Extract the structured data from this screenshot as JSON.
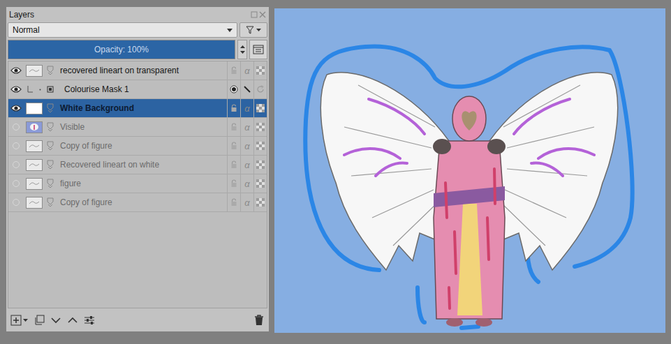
{
  "docker": {
    "title": "Layers",
    "blend_mode": "Normal",
    "opacity": {
      "label": "Opacity:  100%",
      "level": 1.0
    }
  },
  "alpha_glyph": "α",
  "layers": [
    {
      "name": "recovered lineart on transparent",
      "visible": true,
      "selected": false,
      "kind": "paint",
      "thumb": "sketch"
    },
    {
      "name": "Colourise Mask 1",
      "visible": true,
      "selected": false,
      "kind": "mask",
      "thumb": "none"
    },
    {
      "name": "White Background",
      "visible": true,
      "selected": true,
      "kind": "paint",
      "thumb": "white"
    },
    {
      "name": "Visible",
      "visible": false,
      "selected": false,
      "kind": "paint",
      "thumb": "color"
    },
    {
      "name": "Copy of figure",
      "visible": false,
      "selected": false,
      "kind": "paint",
      "thumb": "sketch"
    },
    {
      "name": "Recovered lineart on white",
      "visible": false,
      "selected": false,
      "kind": "paint",
      "thumb": "sketch"
    },
    {
      "name": "figure",
      "visible": false,
      "selected": false,
      "kind": "paint",
      "thumb": "sketch"
    },
    {
      "name": "Copy of figure",
      "visible": false,
      "selected": false,
      "kind": "paint",
      "thumb": "sketch"
    }
  ]
}
